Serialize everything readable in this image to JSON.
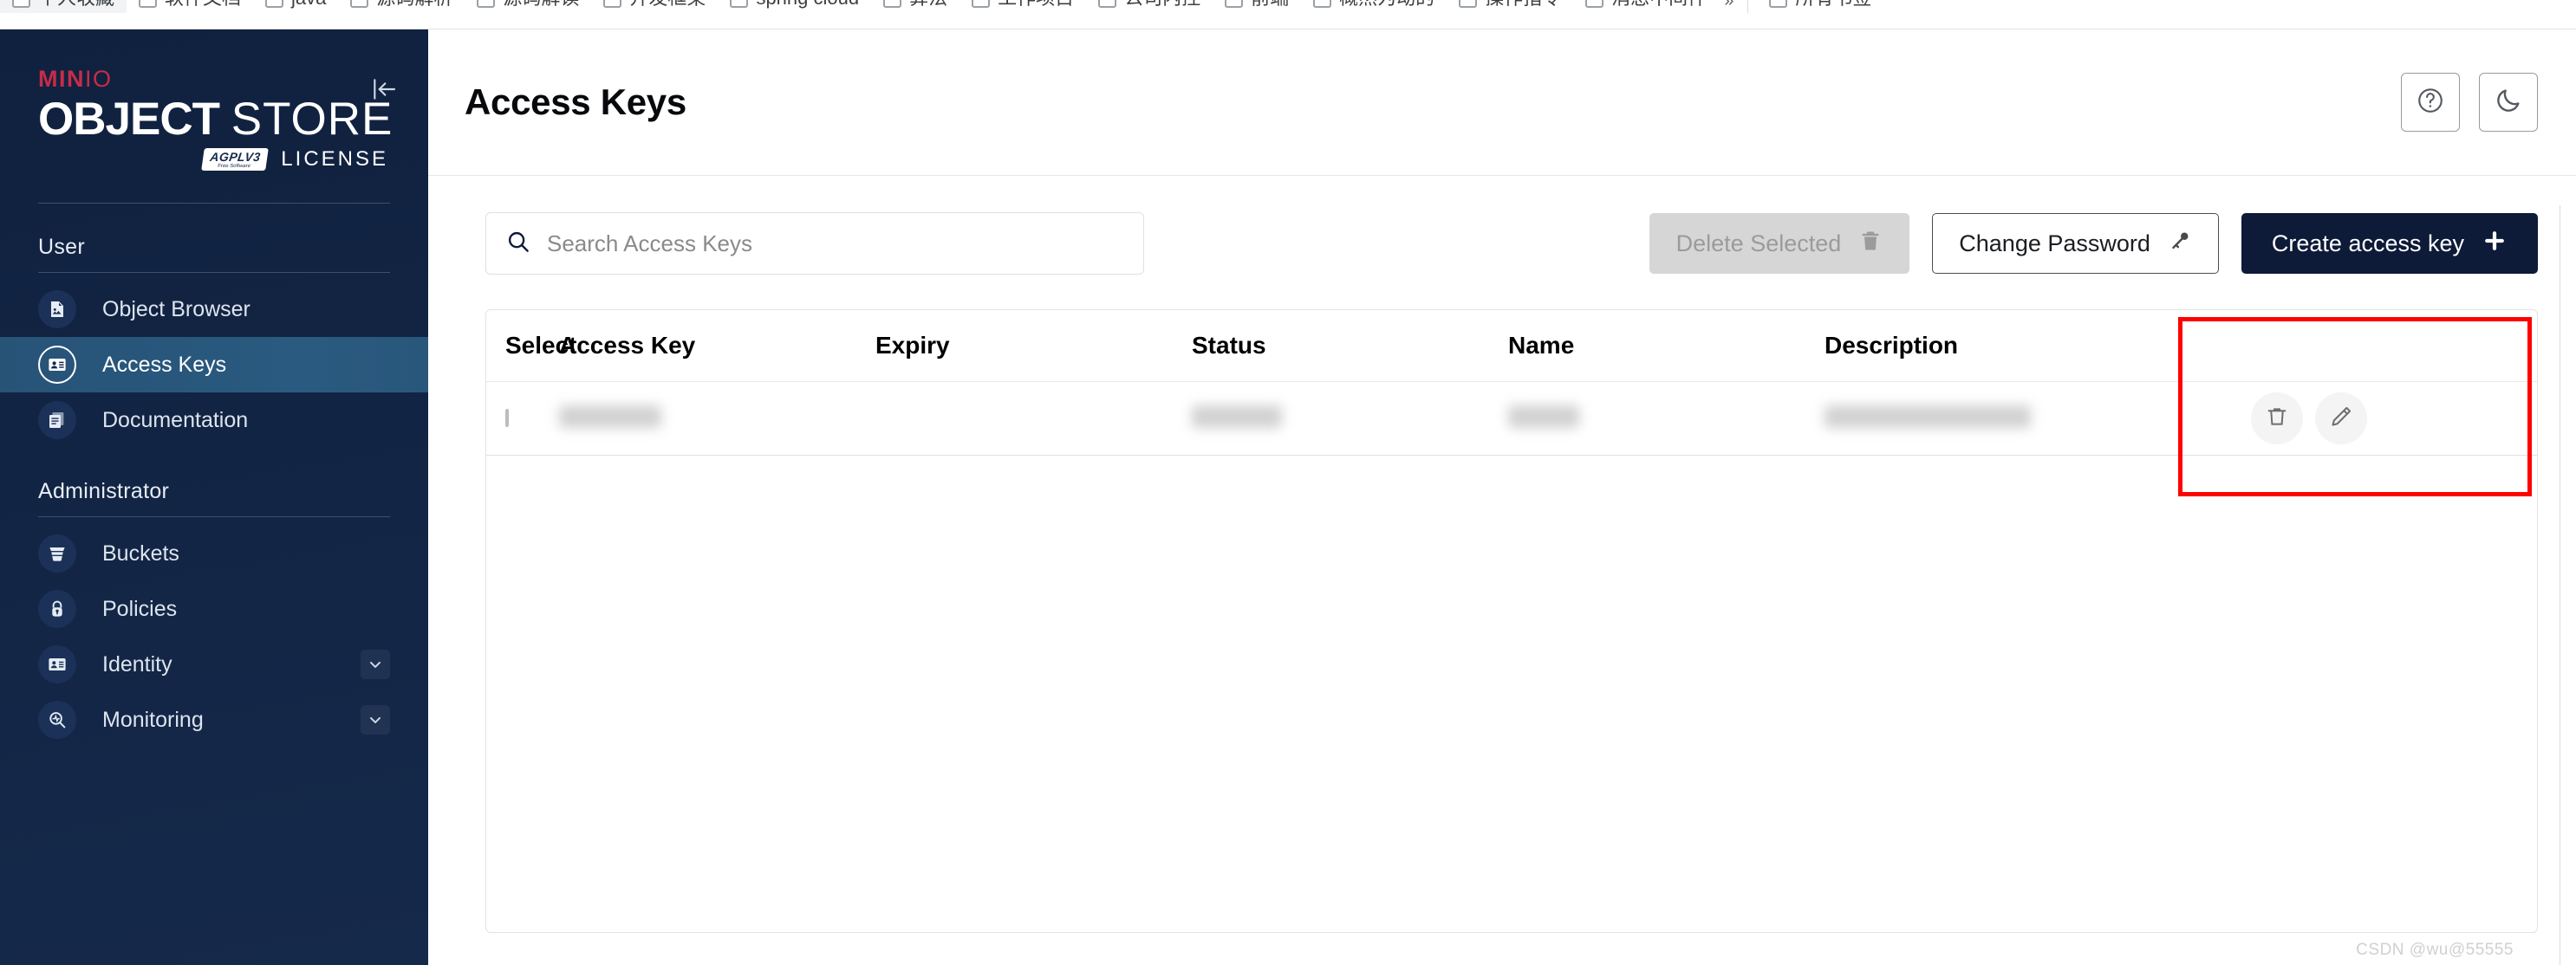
{
  "browser": {
    "bookmarks": [
      {
        "label": "个人收藏",
        "active": true
      },
      {
        "label": "软件文档",
        "active": false
      },
      {
        "label": "java",
        "active": false
      },
      {
        "label": "源码解析",
        "active": false
      },
      {
        "label": "源码解读",
        "active": false
      },
      {
        "label": "开发框架",
        "active": false
      },
      {
        "label": "spring cloud",
        "active": false
      },
      {
        "label": "算法",
        "active": false
      },
      {
        "label": "工作项目",
        "active": false
      },
      {
        "label": "公司内控",
        "active": false
      },
      {
        "label": "前端",
        "active": false
      },
      {
        "label": "概然为动的",
        "active": false
      },
      {
        "label": "操作指令",
        "active": false
      },
      {
        "label": "消息中间件",
        "active": false
      }
    ],
    "overflow_label": "»",
    "trailing_bookmark": "所有书签"
  },
  "sidebar": {
    "logo": {
      "brand": "MIN",
      "brand_suffix": "IO",
      "product_bold": "OBJECT",
      "product_light": "STORE",
      "license_badge": "AGPLV3",
      "license_badge_sub": "Free Software",
      "license_label": "LICENSE"
    },
    "collapse_icon": "collapse-left-icon",
    "sections": [
      {
        "title": "User",
        "items": [
          {
            "label": "Object Browser",
            "icon": "object-browser-icon",
            "active": false,
            "expandable": false
          },
          {
            "label": "Access Keys",
            "icon": "access-keys-icon",
            "active": true,
            "expandable": false
          },
          {
            "label": "Documentation",
            "icon": "documentation-icon",
            "active": false,
            "expandable": false
          }
        ]
      },
      {
        "title": "Administrator",
        "items": [
          {
            "label": "Buckets",
            "icon": "bucket-icon",
            "active": false,
            "expandable": false
          },
          {
            "label": "Policies",
            "icon": "lock-icon",
            "active": false,
            "expandable": false
          },
          {
            "label": "Identity",
            "icon": "identity-card-icon",
            "active": false,
            "expandable": true
          },
          {
            "label": "Monitoring",
            "icon": "monitoring-icon",
            "active": false,
            "expandable": true
          }
        ]
      }
    ]
  },
  "header": {
    "title": "Access Keys",
    "help_icon": "help-circle-icon",
    "theme_icon": "moon-icon"
  },
  "toolbar": {
    "search_placeholder": "Search Access Keys",
    "search_value": "",
    "search_icon": "search-icon",
    "delete_selected_label": "Delete Selected",
    "delete_selected_icon": "trash-icon",
    "delete_selected_disabled": true,
    "change_password_label": "Change Password",
    "change_password_icon": "key-icon",
    "create_access_key_label": "Create access key",
    "create_access_key_icon": "plus-icon"
  },
  "table": {
    "columns": [
      "Select",
      "Access Key",
      "Expiry",
      "Status",
      "Name",
      "Description"
    ],
    "rows": [
      {
        "selected": false,
        "access_key": "",
        "expiry": "",
        "status": "",
        "name": "",
        "description": "",
        "redacted": true,
        "actions": [
          {
            "name": "delete-row-button",
            "icon": "trash-icon"
          },
          {
            "name": "edit-row-button",
            "icon": "pencil-icon"
          }
        ]
      }
    ]
  },
  "annotation": {
    "type": "highlight-rectangle",
    "color": "#ff0000",
    "target": "Create access key"
  },
  "watermark": "CSDN @wu@55555",
  "colors": {
    "sidebar_bg": "#122443",
    "sidebar_active": "#2a5a80",
    "brand_red": "#c72c48",
    "primary_button": "#0d1a38",
    "annotation_red": "#ff0000"
  }
}
